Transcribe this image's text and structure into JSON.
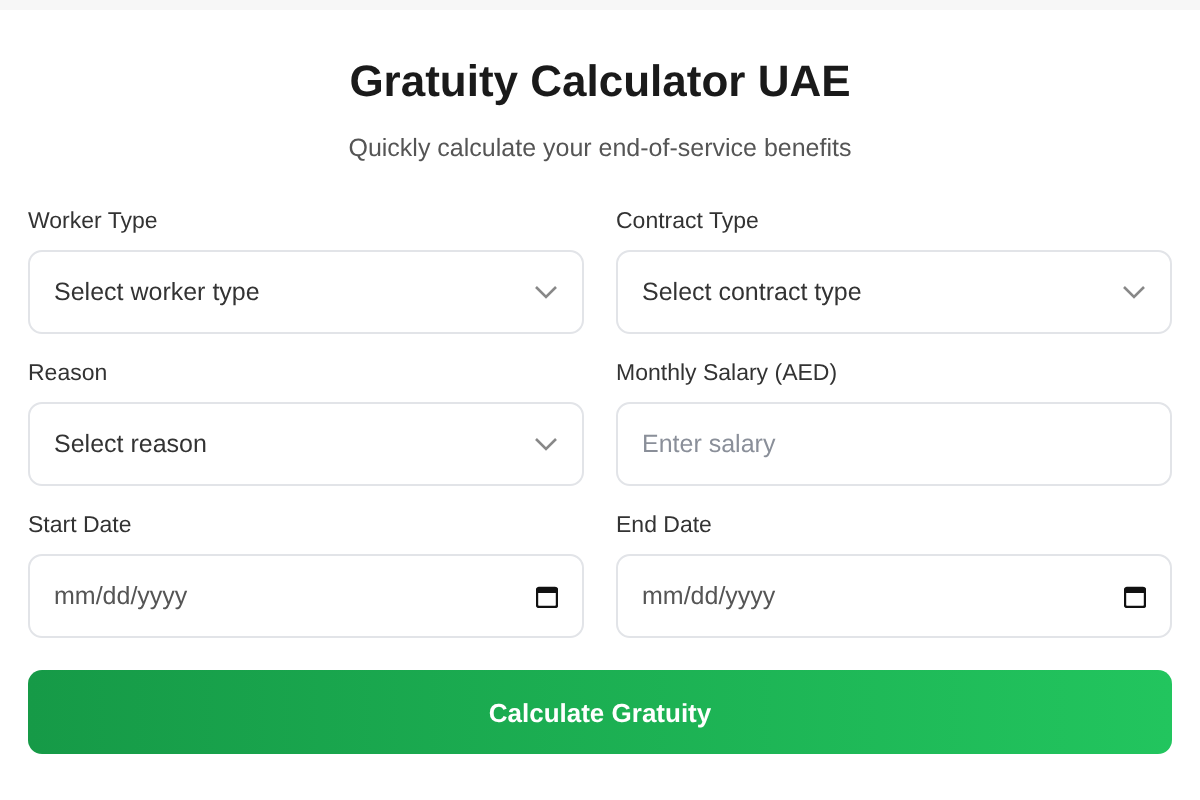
{
  "title": "Gratuity Calculator UAE",
  "subtitle": "Quickly calculate your end-of-service benefits",
  "fields": [
    {
      "label": "Worker Type",
      "kind": "select",
      "placeholder": "Select worker type"
    },
    {
      "label": "Contract Type",
      "kind": "select",
      "placeholder": "Select contract type"
    },
    {
      "label": "Reason",
      "kind": "select",
      "placeholder": "Select reason"
    },
    {
      "label": "Monthly Salary (AED)",
      "kind": "text",
      "placeholder": "Enter salary"
    },
    {
      "label": "Start Date",
      "kind": "date",
      "placeholder": "mm/dd/yyyy"
    },
    {
      "label": "End Date",
      "kind": "date",
      "placeholder": "mm/dd/yyyy"
    }
  ],
  "button": "Calculate Gratuity"
}
